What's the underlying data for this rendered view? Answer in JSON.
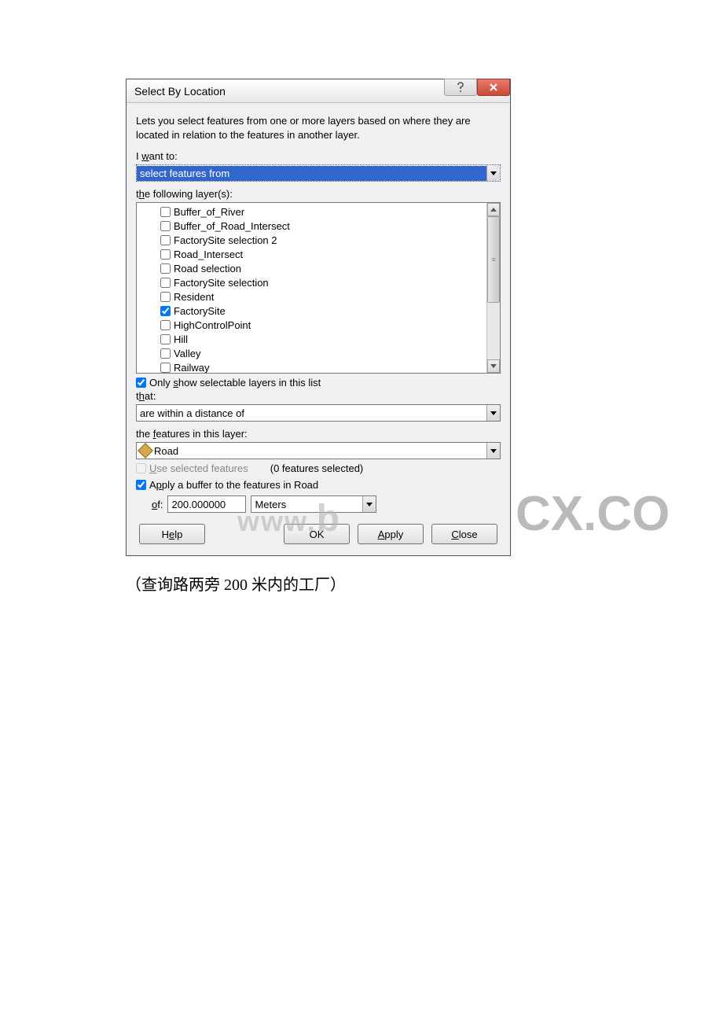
{
  "titlebar": {
    "title": "Select By Location"
  },
  "desc": "Lets you select features from one or more layers based on where they are located in relation to the features in another layer.",
  "iwant_prefix": "I ",
  "iwant_u": "w",
  "iwant_suffix": "ant to:",
  "select_features": "select features from",
  "following_prefix": "t",
  "following_u": "h",
  "following_suffix": "e following layer(s):",
  "layers": [
    {
      "label": "Buffer_of_River",
      "checked": false
    },
    {
      "label": "Buffer_of_Road_Intersect",
      "checked": false
    },
    {
      "label": "FactorySite selection 2",
      "checked": false
    },
    {
      "label": "Road_Intersect",
      "checked": false
    },
    {
      "label": "Road selection",
      "checked": false
    },
    {
      "label": "FactorySite selection",
      "checked": false
    },
    {
      "label": "Resident",
      "checked": false
    },
    {
      "label": "FactorySite",
      "checked": true
    },
    {
      "label": "HighControlPoint",
      "checked": false
    },
    {
      "label": "Hill",
      "checked": false
    },
    {
      "label": "Valley",
      "checked": false
    },
    {
      "label": "Railway",
      "checked": false
    }
  ],
  "only_show_prefix": "Only ",
  "only_show_u": "s",
  "only_show_suffix": "how selectable layers in this list",
  "that_prefix": "t",
  "that_u": "h",
  "that_suffix": "at:",
  "that_option": "are within a distance of",
  "features_prefix": "the ",
  "features_u": "f",
  "features_suffix": "eatures in this layer:",
  "feature_layer": "Road",
  "use_selected_u": "U",
  "use_selected_suffix": "se selected features",
  "features_selected_text": "(0 features selected)",
  "apply_buffer_prefix": "A",
  "apply_buffer_u": "p",
  "apply_buffer_suffix": "ply a buffer to the features in Road",
  "of_u": "o",
  "of_suffix": "f:",
  "buffer_value": "200.000000",
  "buffer_unit": "Meters",
  "buttons": {
    "help_h": "H",
    "help_u": "e",
    "help_s": "lp",
    "ok": "OK",
    "apply_u": "A",
    "apply_s": "pply",
    "close_u": "C",
    "close_s": "lose"
  },
  "watermark_www": "www.",
  "watermark_b": "b",
  "watermark_cx": "CX.CO",
  "caption": "（查询路两旁 200 米内的工厂）"
}
